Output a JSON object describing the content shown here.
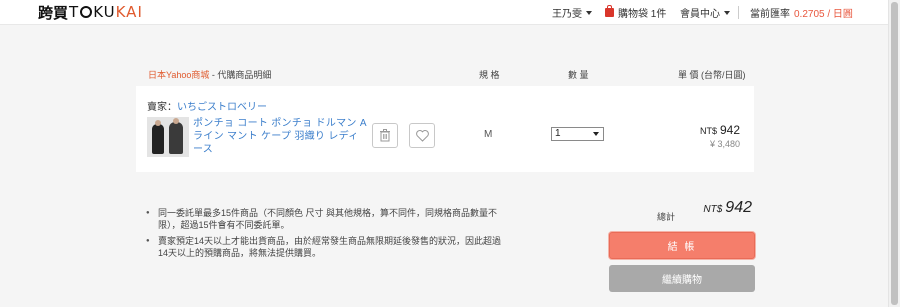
{
  "header": {
    "logo_cn": "跨買",
    "logo_en_left": "T",
    "logo_en_mid": "KU",
    "logo_en_right": "KAI",
    "user": "王乃雯",
    "cart": "購物袋 1件",
    "member": "會員中心",
    "rate_label": "當前匯率",
    "rate_value": "0.2705 / 日圓"
  },
  "table_header": {
    "store_link": "日本Yahoo商城",
    "store_suffix": " - 代購商品明細",
    "spec": "規 格",
    "qty": "數 量",
    "price": "單 價 (台幣/日圓)"
  },
  "item": {
    "seller_label": "賣家：",
    "seller_name": "いちごストロベリー",
    "title": "ポンチョ コート ポンチョ ドルマン Aライン マント ケープ 羽織り レディース",
    "spec": "M",
    "qty": "1",
    "price_currency": "NT$",
    "price_ntd": "942",
    "price_jpy": "¥ 3,480"
  },
  "notes": [
    "同一委託單最多15件商品（不同顏色 尺寸 與其他規格，算不同件，同規格商品數量不限），超過15件會有不同委託單。",
    "賣家預定14天以上才能出貨商品，由於經常發生商品無限期延後發售的狀況，因此超過14天以上的預購商品，將無法提供購買。"
  ],
  "summary": {
    "total_label": "總計",
    "total_currency": "NT$",
    "total_value": "942",
    "checkout_label": "結 帳",
    "continue_label": "繼續購物"
  },
  "colors": {
    "accent": "#e8573e",
    "link": "#3b7ecb",
    "checkout_bg": "#f57e6b",
    "continue_bg": "#a9a9a9"
  }
}
